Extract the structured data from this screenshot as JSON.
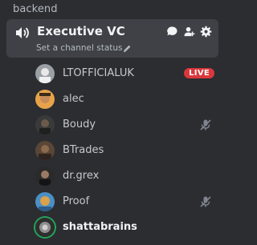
{
  "category": {
    "label": "backend"
  },
  "voice_channel": {
    "name": "Executive VC",
    "status_placeholder": "Set a channel status",
    "actions": [
      "chat-icon",
      "add-member-icon",
      "settings-icon"
    ]
  },
  "members": [
    {
      "name": "LTOFFICIALUK",
      "badge": "LIVE",
      "muted": false,
      "speaking": false
    },
    {
      "name": "alec",
      "muted": false,
      "speaking": false
    },
    {
      "name": "Boudy",
      "muted": true,
      "speaking": false
    },
    {
      "name": "BTrades",
      "muted": false,
      "speaking": false
    },
    {
      "name": "dr.grex",
      "muted": false,
      "speaking": false
    },
    {
      "name": "Proof",
      "muted": true,
      "speaking": false
    },
    {
      "name": "shattabrains",
      "muted": false,
      "speaking": true
    }
  ],
  "colors": {
    "background": "#2b2d31",
    "card": "#3f4147",
    "live_badge": "#da373c",
    "speaking_ring": "#23a55a"
  }
}
